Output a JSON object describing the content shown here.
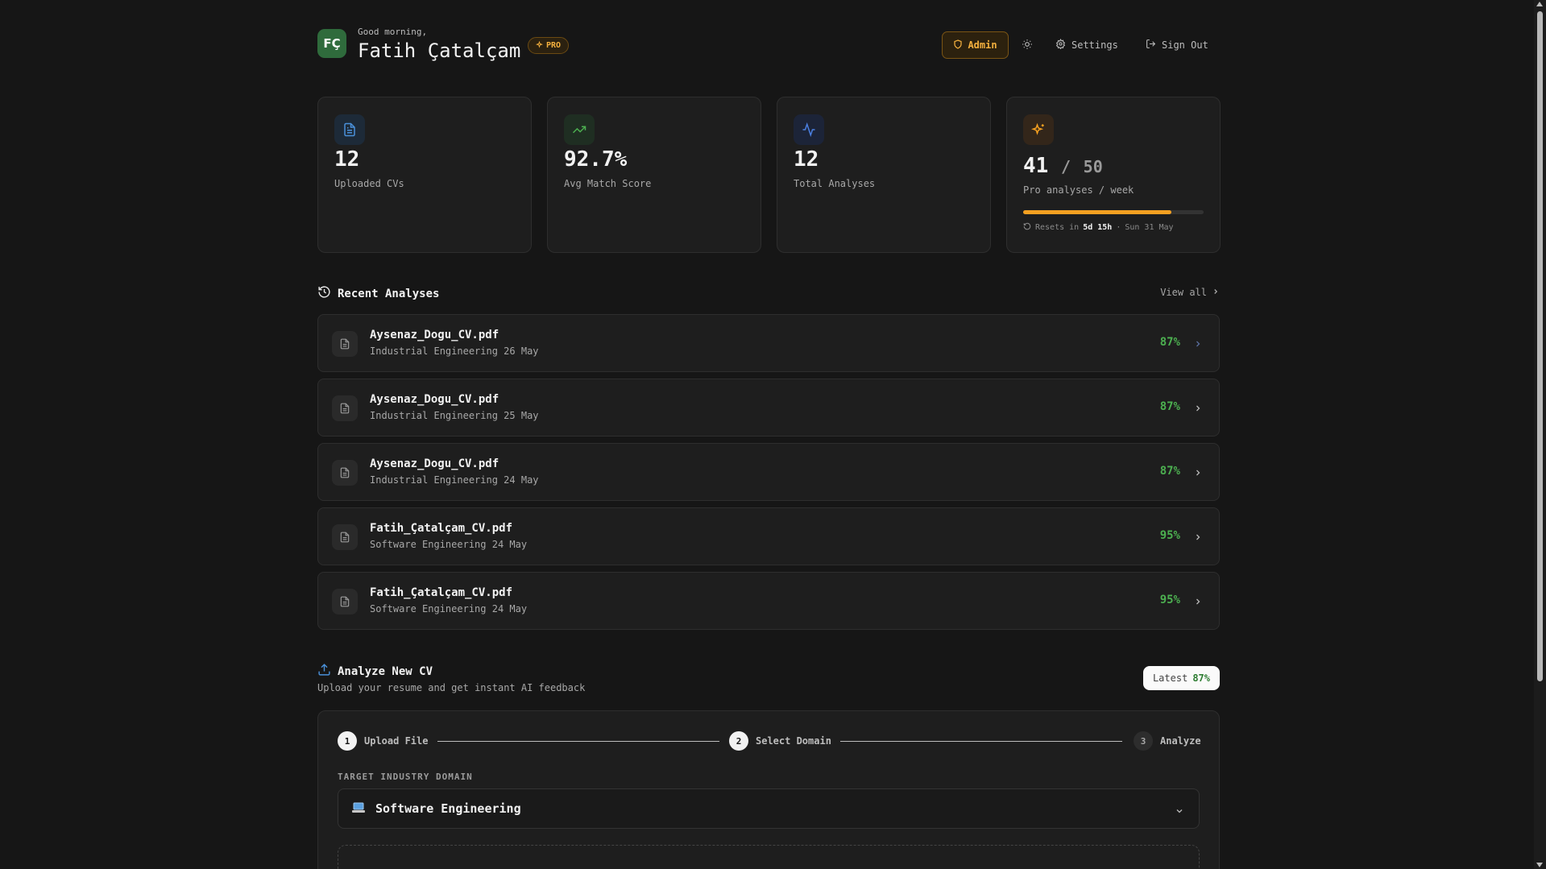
{
  "header": {
    "avatar_initials": "FÇ",
    "greeting": "Good morning,",
    "user_name": "Fatih Çatalçam",
    "pro_badge": "PRO",
    "admin_label": "Admin",
    "settings_label": "Settings",
    "signout_label": "Sign Out"
  },
  "stats": [
    {
      "value": "12",
      "label": "Uploaded CVs",
      "icon": "document-icon",
      "color": "#4a90d9"
    },
    {
      "value": "92.7%",
      "label": "Avg Match Score",
      "icon": "trending-up-icon",
      "color": "#4caf50"
    },
    {
      "value": "12",
      "label": "Total Analyses",
      "icon": "activity-icon",
      "color": "#4a7fe0"
    }
  ],
  "quota": {
    "used": "41",
    "separator": "/",
    "total": "50",
    "label": "Pro analyses / week",
    "progress_fraction": 0.82,
    "reset_prefix": "Resets in",
    "reset_time": "5d 15h",
    "reset_dot": "·",
    "reset_date": "Sun 31 May",
    "color": "#f4a021"
  },
  "recent": {
    "title": "Recent Analyses",
    "view_all": "View all",
    "items": [
      {
        "file": "Aysenaz_Dogu_CV.pdf",
        "meta": "Industrial Engineering 26 May",
        "score": "87%"
      },
      {
        "file": "Aysenaz_Dogu_CV.pdf",
        "meta": "Industrial Engineering 25 May",
        "score": "87%"
      },
      {
        "file": "Aysenaz_Dogu_CV.pdf",
        "meta": "Industrial Engineering 24 May",
        "score": "87%"
      },
      {
        "file": "Fatih_Çatalçam_CV.pdf",
        "meta": "Software Engineering 24 May",
        "score": "95%"
      },
      {
        "file": "Fatih_Çatalçam_CV.pdf",
        "meta": "Software Engineering 24 May",
        "score": "95%"
      }
    ]
  },
  "analyze": {
    "title": "Analyze New CV",
    "subtitle": "Upload your resume and get instant AI feedback",
    "latest_label": "Latest",
    "latest_value": "87%",
    "steps": [
      {
        "num": "1",
        "label": "Upload File",
        "active": true
      },
      {
        "num": "2",
        "label": "Select Domain",
        "active": true
      },
      {
        "num": "3",
        "label": "Analyze",
        "active": false
      }
    ],
    "target_label": "TARGET INDUSTRY DOMAIN",
    "selected_domain": "Software Engineering",
    "domain_icon": "laptop-emoji-icon"
  }
}
